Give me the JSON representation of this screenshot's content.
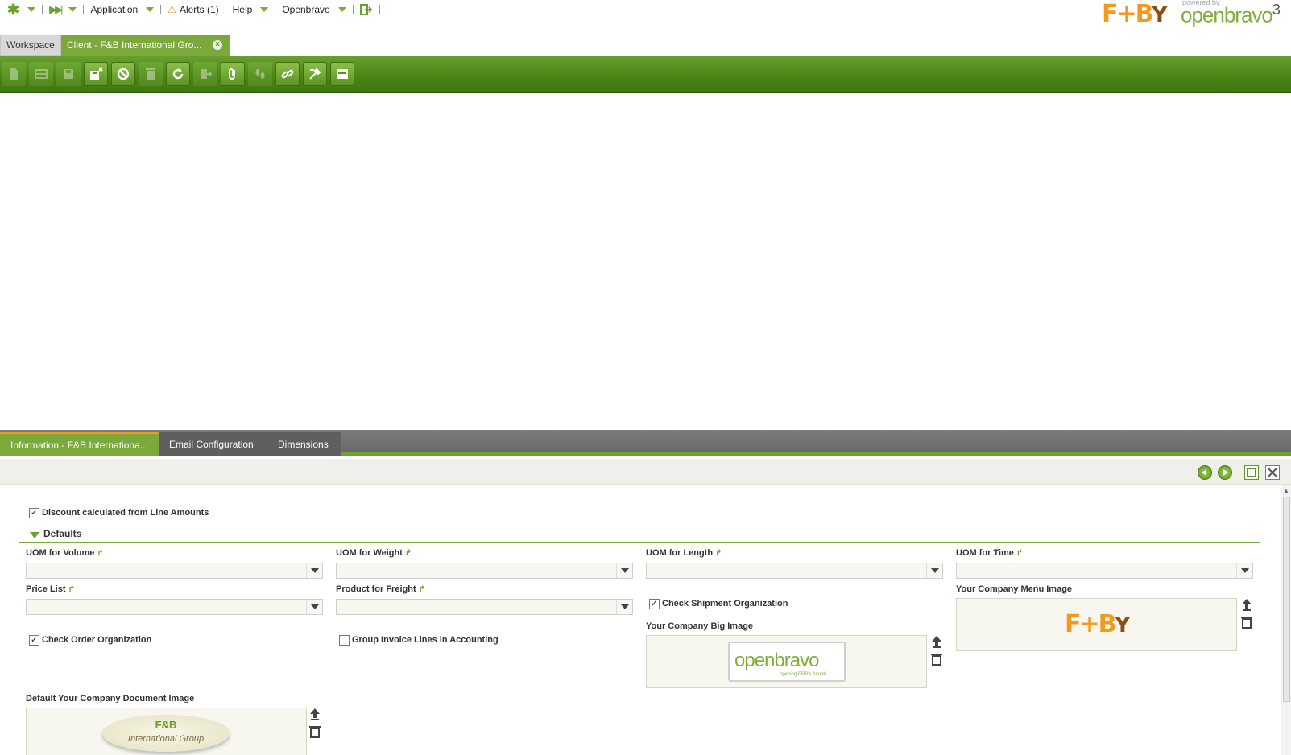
{
  "navbar": {
    "application": "Application",
    "alerts": "Alerts (1)",
    "help": "Help",
    "user": "Openbravo"
  },
  "branding": {
    "client_logo": "F+B",
    "powered_by": "powered by",
    "openbravo": "openbravo",
    "openbravo_version": "3"
  },
  "tabs": {
    "workspace": "Workspace",
    "client": "Client - F&B International Gro..."
  },
  "subtabs": {
    "information": "Information - F&B Internationa...",
    "email": "Email Configuration",
    "dimensions": "Dimensions"
  },
  "form": {
    "discount_label": "Discount calculated from Line Amounts",
    "discount_checked": true,
    "section_defaults": "Defaults",
    "uom_volume": "UOM for Volume",
    "uom_weight": "UOM for Weight",
    "uom_length": "UOM for Length",
    "uom_time": "UOM for Time",
    "price_list": "Price List",
    "product_freight": "Product for Freight",
    "check_shipment_org": "Check Shipment Organization",
    "check_shipment_checked": true,
    "company_menu_image": "Your Company Menu Image",
    "company_big_image": "Your Company Big Image",
    "check_order_org": "Check Order Organization",
    "check_order_checked": true,
    "group_invoice_lines": "Group Invoice Lines in Accounting",
    "group_invoice_checked": false,
    "default_doc_image": "Default Your Company Document Image",
    "big_image_text": "openbravo",
    "big_image_tagline": "opening ERP's future!",
    "doc_image_line1": "F&B",
    "doc_image_line2": "International Group"
  },
  "colors": {
    "brand_green": "#7ba93b",
    "toolbar_green": "#4a8416",
    "accent_orange": "#f39a1e"
  }
}
